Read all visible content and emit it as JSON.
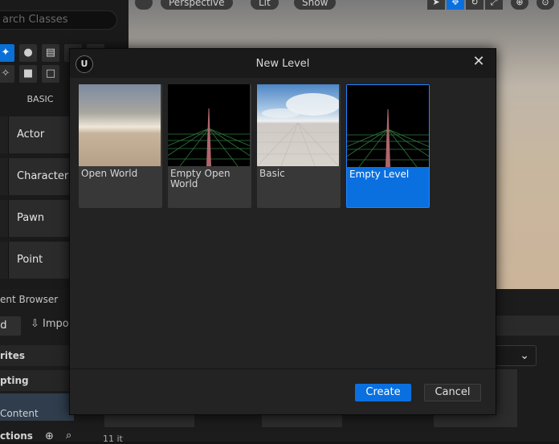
{
  "editor": {
    "search_placeholder": "arch Classes",
    "basic_tab": "BASIC",
    "classes": [
      "Actor",
      "Character",
      "Pawn",
      "Point Light"
    ],
    "viewport": {
      "perspective": "Perspective",
      "lit": "Lit",
      "show": "Show"
    },
    "content_browser": {
      "header": "ent Browser",
      "add": "dd",
      "import": "Impo",
      "tree": [
        "rites",
        "pting"
      ],
      "content": "Content",
      "collections": "ctions",
      "items": "11 it"
    }
  },
  "dialog": {
    "title": "New Level",
    "templates": [
      {
        "label": "Open World",
        "thumb": "open-world"
      },
      {
        "label": "Empty Open World",
        "thumb": "grid"
      },
      {
        "label": "Basic",
        "thumb": "basic"
      },
      {
        "label": "Empty Level",
        "thumb": "grid",
        "selected": true
      }
    ],
    "create_label": "Create",
    "cancel_label": "Cancel"
  },
  "colors": {
    "accent": "#0a70e0",
    "dialog_bg": "#232323",
    "tile_bg": "#383838"
  }
}
